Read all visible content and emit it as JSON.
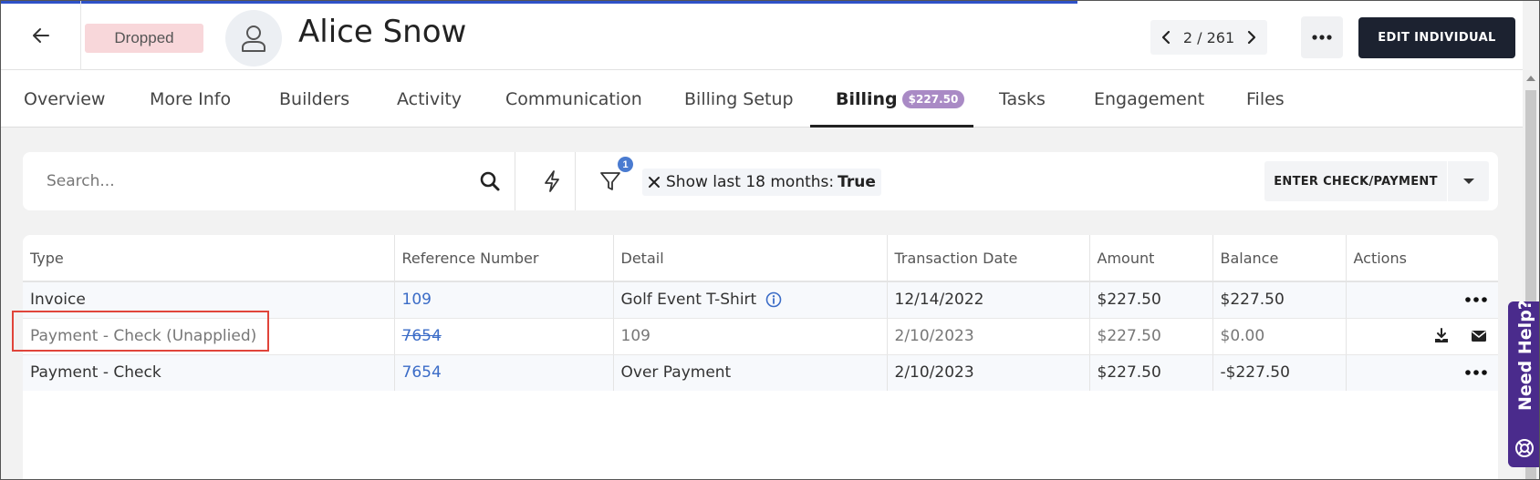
{
  "header": {
    "status": "Dropped",
    "name": "Alice Snow",
    "pager": "2 / 261",
    "edit_label": "EDIT INDIVIDUAL"
  },
  "tabs": [
    {
      "label": "Overview"
    },
    {
      "label": "More Info"
    },
    {
      "label": "Builders"
    },
    {
      "label": "Activity"
    },
    {
      "label": "Communication"
    },
    {
      "label": "Billing Setup"
    },
    {
      "label": "Billing",
      "badge": "$227.50",
      "active": true
    },
    {
      "label": "Tasks"
    },
    {
      "label": "Engagement"
    },
    {
      "label": "Files"
    }
  ],
  "toolbar": {
    "search_placeholder": "Search...",
    "filter_count": "1",
    "filter_chip_label": "Show last 18 months:",
    "filter_chip_value": "True",
    "enter_payment_label": "ENTER CHECK/PAYMENT"
  },
  "table": {
    "columns": [
      "Type",
      "Reference Number",
      "Detail",
      "Transaction Date",
      "Amount",
      "Balance",
      "Actions"
    ],
    "rows": [
      {
        "type": "Invoice",
        "reference": "109",
        "detail": "Golf Event T-Shirt",
        "date": "12/14/2022",
        "amount": "$227.50",
        "balance": "$227.50"
      },
      {
        "type": "Payment - Check (Unapplied)",
        "reference": "7654",
        "detail": "109",
        "date": "2/10/2023",
        "amount": "$227.50",
        "balance": "$0.00"
      },
      {
        "type": "Payment - Check",
        "reference": "7654",
        "detail": "Over Payment",
        "date": "2/10/2023",
        "amount": "$227.50",
        "balance": "-$227.50"
      }
    ]
  },
  "help": {
    "label": "Need Help?"
  },
  "colors": {
    "accent": "#2f52c8",
    "dark_button": "#1c2230",
    "status_badge_bg": "#f8d7da",
    "billing_badge": "#a98ac5",
    "link": "#3b6cc7",
    "highlight": "#e0443a",
    "help_tab": "#4a2b8c"
  }
}
